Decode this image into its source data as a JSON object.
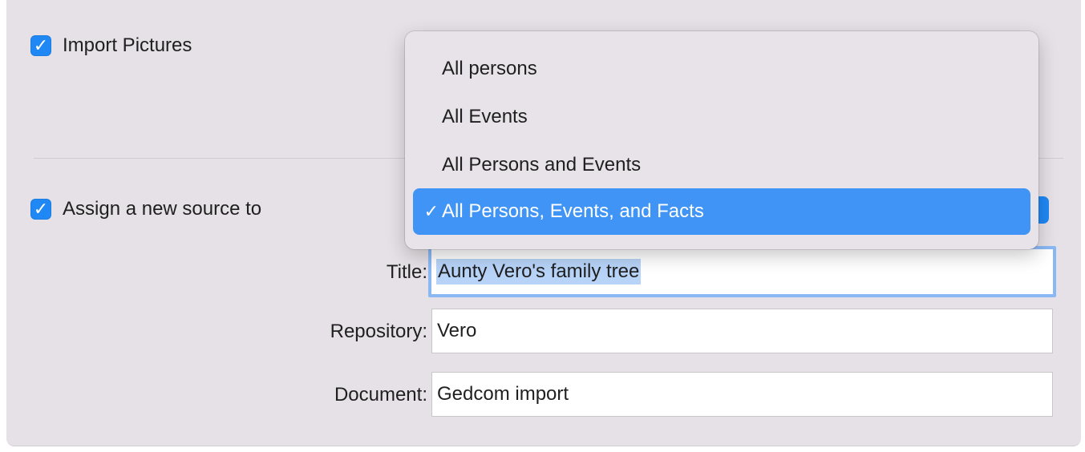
{
  "options": {
    "import_pictures": {
      "label": "Import Pictures",
      "checked": true,
      "check_glyph": "✓"
    },
    "assign_source": {
      "label": "Assign a new source to",
      "checked": true,
      "check_glyph": "✓"
    }
  },
  "source_fields": {
    "title": {
      "label": "Title:",
      "value": "Aunty Vero's family tree"
    },
    "repository": {
      "label": "Repository:",
      "value": "Vero"
    },
    "document": {
      "label": "Document:",
      "value": "Gedcom import"
    }
  },
  "scope_menu": {
    "items": [
      {
        "label": "All persons",
        "mark": ""
      },
      {
        "label": "All Events",
        "mark": ""
      },
      {
        "label": "All Persons and Events",
        "mark": ""
      },
      {
        "label": "All Persons, Events, and Facts",
        "mark": "✓"
      }
    ],
    "selected_index": 3
  },
  "colors": {
    "accent": "#1f88f5",
    "menu_highlight": "#3f94f6",
    "panel_background": "#e5e1e6",
    "focus_ring": "#8ab8f4",
    "text_selection": "#b7d3f7"
  }
}
